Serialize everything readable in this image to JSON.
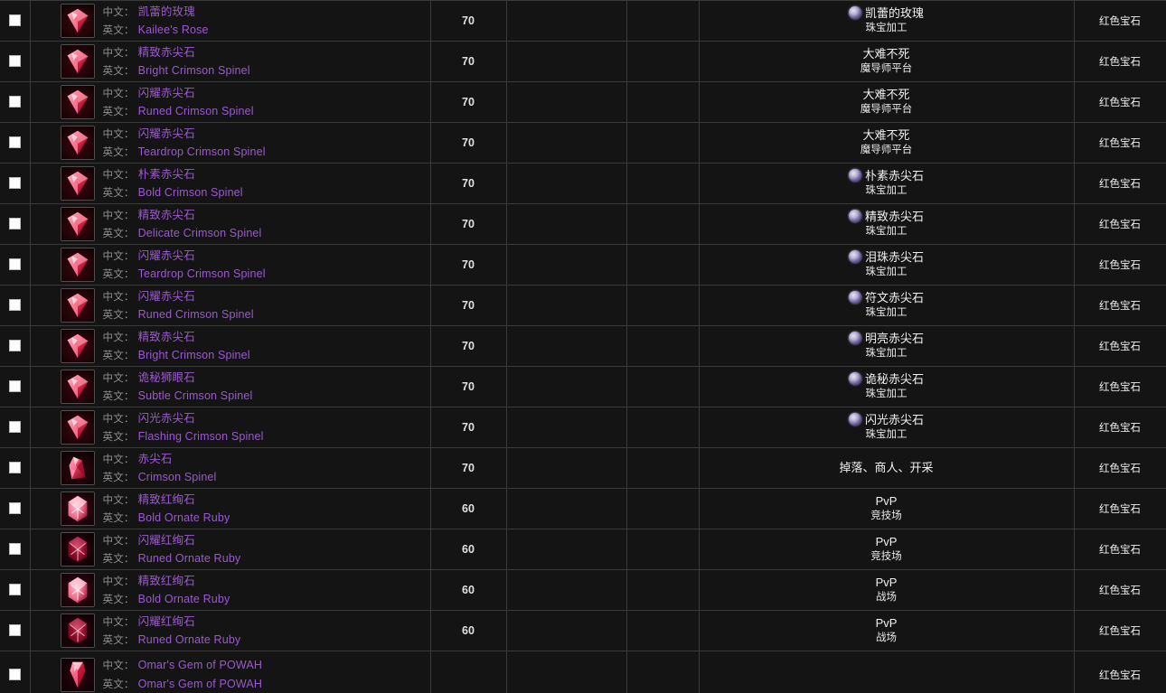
{
  "table": {
    "labels": {
      "cn_label": "中文：",
      "en_label": "英文："
    },
    "columns": [
      "checkbox",
      "item-name",
      "item-level",
      "blank-a",
      "blank-b",
      "source",
      "gem-type"
    ],
    "rows": [
      {
        "icon": "crimson-spinel-cut-icon",
        "cn": "凯蕾的玫瑰",
        "en": "Kailee's Rose",
        "level": "70",
        "blank_a": "",
        "blank_b": "",
        "source_icon": "jewelcrafting-spell-icon",
        "source_1": "凯蕾的玫瑰",
        "source_2": "珠宝加工",
        "type": "红色宝石"
      },
      {
        "icon": "crimson-spinel-cut-icon",
        "cn": "精致赤尖石",
        "en": "Bright Crimson Spinel",
        "level": "70",
        "blank_a": "",
        "blank_b": "",
        "source_icon": "",
        "source_1": "大难不死",
        "source_2": "魔导师平台",
        "type": "红色宝石"
      },
      {
        "icon": "crimson-spinel-cut-icon",
        "cn": "闪耀赤尖石",
        "en": "Runed Crimson Spinel",
        "level": "70",
        "blank_a": "",
        "blank_b": "",
        "source_icon": "",
        "source_1": "大难不死",
        "source_2": "魔导师平台",
        "type": "红色宝石"
      },
      {
        "icon": "crimson-spinel-cut-icon",
        "cn": "闪耀赤尖石",
        "en": "Teardrop Crimson Spinel",
        "level": "70",
        "blank_a": "",
        "blank_b": "",
        "source_icon": "",
        "source_1": "大难不死",
        "source_2": "魔导师平台",
        "type": "红色宝石"
      },
      {
        "icon": "crimson-spinel-cut-icon",
        "cn": "朴素赤尖石",
        "en": "Bold Crimson Spinel",
        "level": "70",
        "blank_a": "",
        "blank_b": "",
        "source_icon": "jewelcrafting-spell-icon",
        "source_1": "朴素赤尖石",
        "source_2": "珠宝加工",
        "type": "红色宝石"
      },
      {
        "icon": "crimson-spinel-cut-icon",
        "cn": "精致赤尖石",
        "en": "Delicate Crimson Spinel",
        "level": "70",
        "blank_a": "",
        "blank_b": "",
        "source_icon": "jewelcrafting-spell-icon",
        "source_1": "精致赤尖石",
        "source_2": "珠宝加工",
        "type": "红色宝石"
      },
      {
        "icon": "crimson-spinel-cut-icon",
        "cn": "闪耀赤尖石",
        "en": "Teardrop Crimson Spinel",
        "level": "70",
        "blank_a": "",
        "blank_b": "",
        "source_icon": "jewelcrafting-spell-icon",
        "source_1": "泪珠赤尖石",
        "source_2": "珠宝加工",
        "type": "红色宝石"
      },
      {
        "icon": "crimson-spinel-cut-icon",
        "cn": "闪耀赤尖石",
        "en": "Runed Crimson Spinel",
        "level": "70",
        "blank_a": "",
        "blank_b": "",
        "source_icon": "jewelcrafting-spell-icon",
        "source_1": "符文赤尖石",
        "source_2": "珠宝加工",
        "type": "红色宝石"
      },
      {
        "icon": "crimson-spinel-cut-icon",
        "cn": "精致赤尖石",
        "en": "Bright Crimson Spinel",
        "level": "70",
        "blank_a": "",
        "blank_b": "",
        "source_icon": "jewelcrafting-spell-icon",
        "source_1": "明亮赤尖石",
        "source_2": "珠宝加工",
        "type": "红色宝石"
      },
      {
        "icon": "crimson-spinel-cut-icon",
        "cn": "诡秘狮眼石",
        "en": "Subtle Crimson Spinel",
        "level": "70",
        "blank_a": "",
        "blank_b": "",
        "source_icon": "jewelcrafting-spell-icon",
        "source_1": "诡秘赤尖石",
        "source_2": "珠宝加工",
        "type": "红色宝石"
      },
      {
        "icon": "crimson-spinel-cut-icon",
        "cn": "闪光赤尖石",
        "en": "Flashing Crimson Spinel",
        "level": "70",
        "blank_a": "",
        "blank_b": "",
        "source_icon": "jewelcrafting-spell-icon",
        "source_1": "闪光赤尖石",
        "source_2": "珠宝加工",
        "type": "红色宝石"
      },
      {
        "icon": "crimson-spinel-raw-icon",
        "cn": "赤尖石",
        "en": "Crimson Spinel",
        "level": "70",
        "blank_a": "",
        "blank_b": "",
        "source_icon": "",
        "source_1": "掉落、商人、开采",
        "source_2": "",
        "type": "红色宝石"
      },
      {
        "icon": "ornate-ruby-bright-icon",
        "cn": "精致红绚石",
        "en": "Bold Ornate Ruby",
        "level": "60",
        "blank_a": "",
        "blank_b": "",
        "source_icon": "",
        "source_1": "PvP",
        "source_2": "竞技场",
        "type": "红色宝石"
      },
      {
        "icon": "ornate-ruby-dark-icon",
        "cn": "闪耀红绚石",
        "en": "Runed Ornate Ruby",
        "level": "60",
        "blank_a": "",
        "blank_b": "",
        "source_icon": "",
        "source_1": "PvP",
        "source_2": "竞技场",
        "type": "红色宝石"
      },
      {
        "icon": "ornate-ruby-bright-icon",
        "cn": "精致红绚石",
        "en": "Bold Ornate Ruby",
        "level": "60",
        "blank_a": "",
        "blank_b": "",
        "source_icon": "",
        "source_1": "PvP",
        "source_2": "战场",
        "type": "红色宝石"
      },
      {
        "icon": "ornate-ruby-dark-icon",
        "cn": "闪耀红绚石",
        "en": "Runed Ornate Ruby",
        "level": "60",
        "blank_a": "",
        "blank_b": "",
        "source_icon": "",
        "source_1": "PvP",
        "source_2": "战场",
        "type": "红色宝石"
      },
      {
        "icon": "omars-gem-icon",
        "cn": "Omar's Gem of POWAH",
        "en": "Omar's Gem of POWAH",
        "level": "",
        "blank_a": "",
        "blank_b": "",
        "source_icon": "",
        "source_1": "",
        "source_2": "",
        "type": "红色宝石"
      }
    ]
  },
  "colors": {
    "item_name": "#9b59d0",
    "label_gray": "#8e8e8e",
    "cell_bg": "#141414",
    "border": "#3a3a3a",
    "text_light": "#f0f0f0"
  }
}
